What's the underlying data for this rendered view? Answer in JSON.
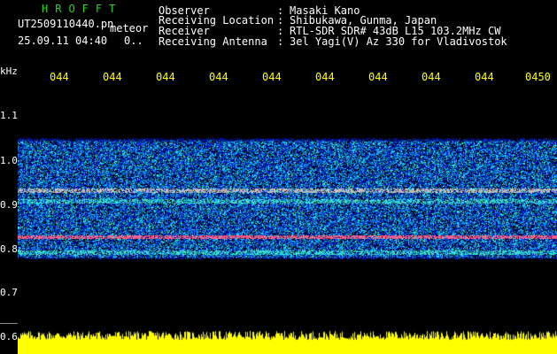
{
  "header": {
    "brand": "HROFFT",
    "filename": "UT2509110440.pn",
    "meteor_label": "meteor",
    "datetime": "25.09.11 04:40",
    "count": "0.."
  },
  "info": {
    "rows": [
      {
        "label": "Observer",
        "sep": ":",
        "value": "Masaki Kano"
      },
      {
        "label": "Receiving Location",
        "sep": ":",
        "value": "Shibukawa, Gunma, Japan"
      },
      {
        "label": "Receiver",
        "sep": ":",
        "value": "RTL-SDR SDR# 43dB L15 103.2MHz CW"
      },
      {
        "label": "Receiving Antenna",
        "sep": ":",
        "value": "3el Yagi(V) Az 330 for Vladivostok"
      }
    ]
  },
  "axis": {
    "y_unit": "kHz",
    "y_ticks": [
      "1.1",
      "1.0",
      "0.9",
      "0.8",
      "0.7",
      "0.6"
    ],
    "x_ticks": [
      "044",
      "044",
      "044",
      "044",
      "044",
      "044",
      "044",
      "044",
      "044",
      "0450"
    ]
  },
  "colors": {
    "background": "#000000",
    "header_green": "#2bd42b",
    "tick_yellow": "#ffff00",
    "power_yellow": "#ffff00",
    "noise_blue": "#1a3cff",
    "band_red": "#ff2040"
  },
  "spectrogram": {
    "freq_range_khz": [
      0.6,
      1.15
    ],
    "noise_band_khz": [
      0.78,
      1.04
    ],
    "bright_lines_khz": [
      0.825,
      0.93,
      0.79,
      0.905
    ]
  }
}
